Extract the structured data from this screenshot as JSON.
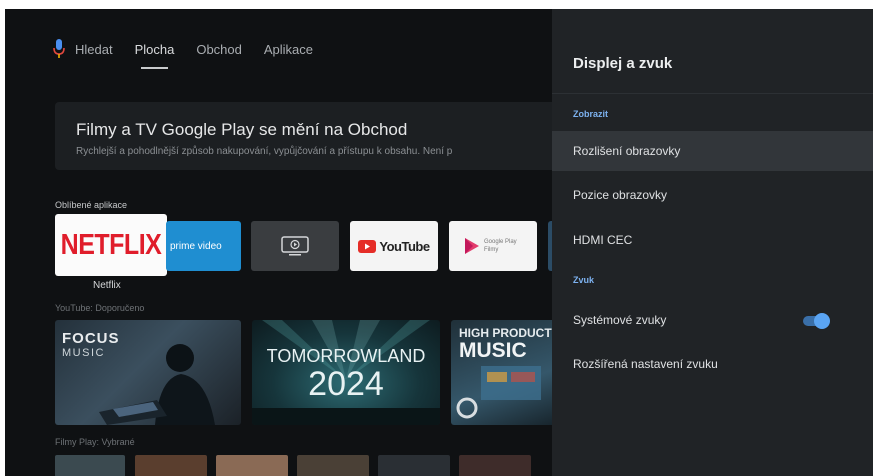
{
  "nav": {
    "items": [
      {
        "label": "Hledat"
      },
      {
        "label": "Plocha"
      },
      {
        "label": "Obchod"
      },
      {
        "label": "Aplikace"
      }
    ],
    "active": "Plocha"
  },
  "banner": {
    "title": "Filmy a TV Google Play se mění na Obchod",
    "subtitle": "Rychlejší a pohodlnější způsob nakupování, vypůjčování a přístupu k obsahu. Není p"
  },
  "sections": {
    "favorites": "Oblíbené aplikace",
    "youtube": "YouTube: Doporučeno",
    "films": "Filmy Play: Vybrané"
  },
  "apps": {
    "netflix_logo": "NETFLIX",
    "netflix_label": "Netflix",
    "prime_label": "prime video",
    "youtube_label": "YouTube",
    "googleplay_label": "Google Play Filmy"
  },
  "cards": {
    "focus_title": "FOCUS",
    "focus_sub": "MUSIC",
    "tml_title": "TOMORROWLAND",
    "tml_year": "2024",
    "hp_title": "HIGH PRODUCT",
    "hp_sub": "MUSIC"
  },
  "panel": {
    "title": "Displej a zvuk",
    "display_header": "Zobrazit",
    "items_display": [
      {
        "label": "Rozlišení obrazovky",
        "selected": true
      },
      {
        "label": "Pozice obrazovky",
        "selected": false
      },
      {
        "label": "HDMI CEC",
        "selected": false
      }
    ],
    "sound_header": "Zvuk",
    "system_sounds": {
      "label": "Systémové zvuky",
      "enabled": true
    },
    "advanced_sound": {
      "label": "Rozšířená nastavení zvuku"
    }
  },
  "colors": {
    "accent": "#5aa4f2",
    "netflix_red": "#e01d2b",
    "prime_blue": "#1f8ed1"
  }
}
